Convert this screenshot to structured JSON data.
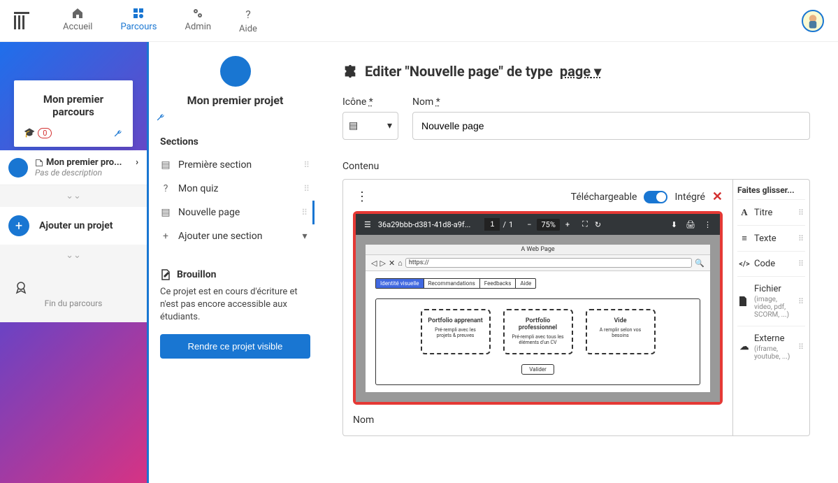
{
  "nav": {
    "accueil": "Accueil",
    "parcours": "Parcours",
    "admin": "Admin",
    "aide": "Aide"
  },
  "parcours": {
    "title": "Mon premier parcours",
    "count": "0"
  },
  "project_row": {
    "name": "Mon premier pro...",
    "desc": "Pas de description"
  },
  "add_project": "Ajouter un projet",
  "fin_parcours": "Fin du parcours",
  "project": {
    "title": "Mon premier projet"
  },
  "sections": {
    "header": "Sections",
    "items": [
      "Première section",
      "Mon quiz",
      "Nouvelle page"
    ],
    "add": "Ajouter une section"
  },
  "brouillon": {
    "title": "Brouillon",
    "text": "Ce projet est en cours d'écriture et n'est pas encore accessible aux étudiants.",
    "button": "Rendre ce projet visible"
  },
  "editor": {
    "prefix": "Editer \"Nouvelle page\" de type",
    "type": "page",
    "icon_label": "Icône",
    "name_label": "Nom",
    "name_value": "Nouvelle page",
    "contenu": "Contenu",
    "downloadable": "Téléchargeable",
    "integre": "Intégré",
    "nom2": "Nom"
  },
  "pdf": {
    "filename": "36a29bbb-d381-41d8-a9f...",
    "page_current": "1",
    "page_sep": "/",
    "page_total": "1",
    "zoom": "75%"
  },
  "mockup": {
    "page_title": "A Web Page",
    "url": "https://",
    "tabs": [
      "Identité visuelle",
      "Recommandations",
      "Feedbacks",
      "Aide"
    ],
    "cards": [
      {
        "title": "Portfolio apprenant",
        "sub": "Pré-rempli avec les projets & preuves"
      },
      {
        "title": "Portfolio professionnel",
        "sub": "Pré-rempli avec tous les éléments d'un CV"
      },
      {
        "title": "Vide",
        "sub": "A remplir selon vos besoins"
      }
    ],
    "valider": "Valider"
  },
  "widgets": {
    "title": "Faites glisser...",
    "items": [
      {
        "icon": "A",
        "label": "Titre"
      },
      {
        "icon": "≡",
        "label": "Texte"
      },
      {
        "icon": "</>",
        "label": "Code"
      },
      {
        "icon": "▪",
        "label": "Fichier",
        "sub": "(image, video, pdf, SCORM, ...)"
      },
      {
        "icon": "☁",
        "label": "Externe",
        "sub": "(iframe, youtube, ...)"
      }
    ]
  }
}
